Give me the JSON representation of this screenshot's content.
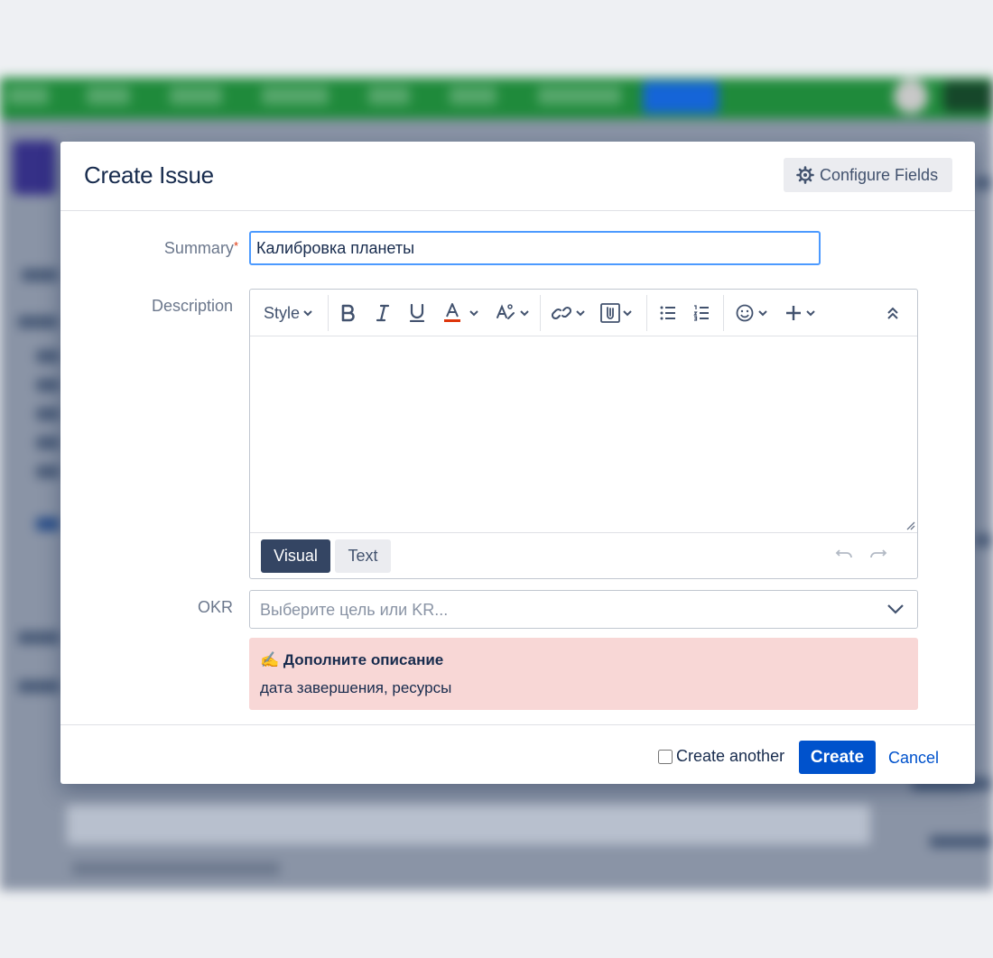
{
  "dialog": {
    "title": "Create Issue",
    "configure_fields_label": "Configure Fields"
  },
  "summary": {
    "label": "Summary",
    "required_marker": "*",
    "value": "Калибровка планеты"
  },
  "description": {
    "label": "Description",
    "toolbar": {
      "style_label": "Style"
    },
    "tabs": {
      "visual": "Visual",
      "text": "Text"
    }
  },
  "okr": {
    "label": "OKR",
    "placeholder": "Выберите цель или KR..."
  },
  "warning": {
    "title": "✍ Дополните описание",
    "text": "дата завершения, ресурсы",
    "background_color": "#f8d7d6"
  },
  "footer": {
    "create_another_label": "Create another",
    "create_another_checked": false,
    "create_label": "Create",
    "cancel_label": "Cancel"
  },
  "colors": {
    "primary": "#0052cc",
    "focus_border": "#4c9aff",
    "topbar_green": "#1f8a3b",
    "visual_tab": "#344563"
  }
}
